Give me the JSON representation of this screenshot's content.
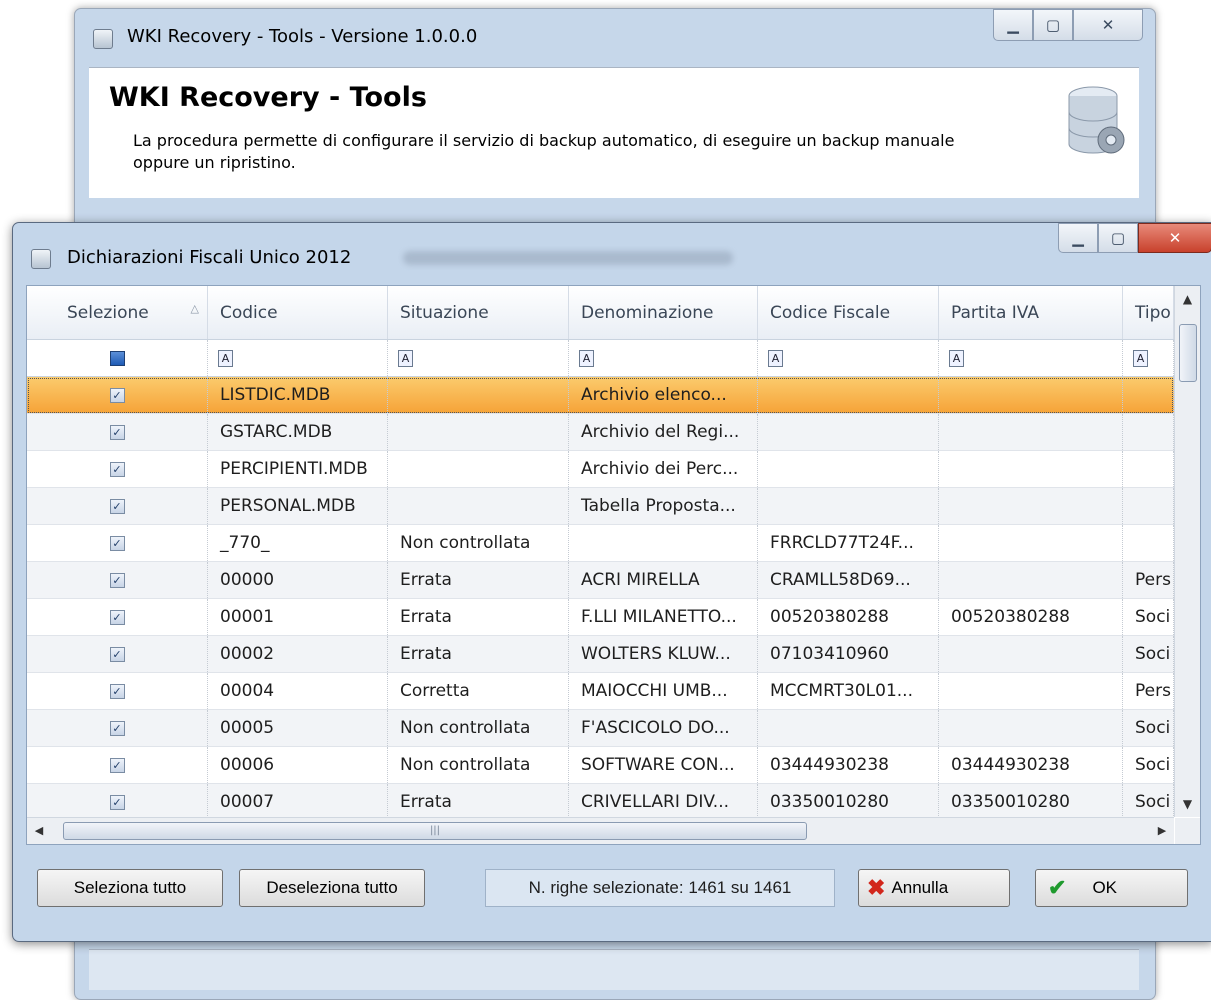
{
  "back_window": {
    "title": "WKI Recovery - Tools - Versione 1.0.0.0",
    "heading": "WKI Recovery - Tools",
    "description": "La procedura permette di configurare il servizio di backup automatico, di eseguire un backup manuale oppure un ripristino.",
    "icon": "database-gear-icon"
  },
  "dialog": {
    "title": "Dichiarazioni Fiscali Unico 2012",
    "columns": [
      "Selezione",
      "Codice",
      "Situazione",
      "Denominazione",
      "Codice Fiscale",
      "Partita IVA",
      "Tipo"
    ],
    "filter_icon": "A",
    "rows": [
      {
        "codice": "LISTDIC.MDB",
        "situazione": "",
        "denominazione": "Archivio elenco...",
        "codice_fiscale": "",
        "partita_iva": "",
        "tipo": ""
      },
      {
        "codice": "GSTARC.MDB",
        "situazione": "",
        "denominazione": "Archivio del Regi...",
        "codice_fiscale": "",
        "partita_iva": "",
        "tipo": ""
      },
      {
        "codice": "PERCIPIENTI.MDB",
        "situazione": "",
        "denominazione": "Archivio dei Perc...",
        "codice_fiscale": "",
        "partita_iva": "",
        "tipo": ""
      },
      {
        "codice": "PERSONAL.MDB",
        "situazione": "",
        "denominazione": "Tabella Proposta...",
        "codice_fiscale": "",
        "partita_iva": "",
        "tipo": ""
      },
      {
        "codice": "_770_",
        "situazione": "Non controllata",
        "denominazione": "",
        "codice_fiscale": "FRRCLD77T24F...",
        "partita_iva": "",
        "tipo": ""
      },
      {
        "codice": "00000",
        "situazione": "Errata",
        "denominazione": "ACRI MIRELLA",
        "codice_fiscale": "CRAMLL58D69...",
        "partita_iva": "",
        "tipo": "Pers"
      },
      {
        "codice": "00001",
        "situazione": "Errata",
        "denominazione": "F.LLI MILANETTO...",
        "codice_fiscale": "00520380288",
        "partita_iva": "00520380288",
        "tipo": "Soci"
      },
      {
        "codice": "00002",
        "situazione": "Errata",
        "denominazione": "WOLTERS KLUW...",
        "codice_fiscale": "07103410960",
        "partita_iva": "",
        "tipo": "Soci"
      },
      {
        "codice": "00004",
        "situazione": "Corretta",
        "denominazione": "MAIOCCHI UMB...",
        "codice_fiscale": "MCCMRT30L01...",
        "partita_iva": "",
        "tipo": "Pers"
      },
      {
        "codice": "00005",
        "situazione": "Non controllata",
        "denominazione": "F'ASCICOLO DO...",
        "codice_fiscale": "",
        "partita_iva": "",
        "tipo": "Soci"
      },
      {
        "codice": "00006",
        "situazione": "Non controllata",
        "denominazione": "SOFTWARE CON...",
        "codice_fiscale": "03444930238",
        "partita_iva": "03444930238",
        "tipo": "Soci"
      },
      {
        "codice": "00007",
        "situazione": "Errata",
        "denominazione": "CRIVELLARI DIV...",
        "codice_fiscale": "03350010280",
        "partita_iva": "03350010280",
        "tipo": "Soci"
      }
    ],
    "buttons": {
      "select_all": "Seleziona tutto",
      "deselect_all": "Deseleziona tutto",
      "cancel": "Annulla",
      "ok": "OK"
    },
    "status": "N. righe selezionate: 1461 su 1461"
  }
}
